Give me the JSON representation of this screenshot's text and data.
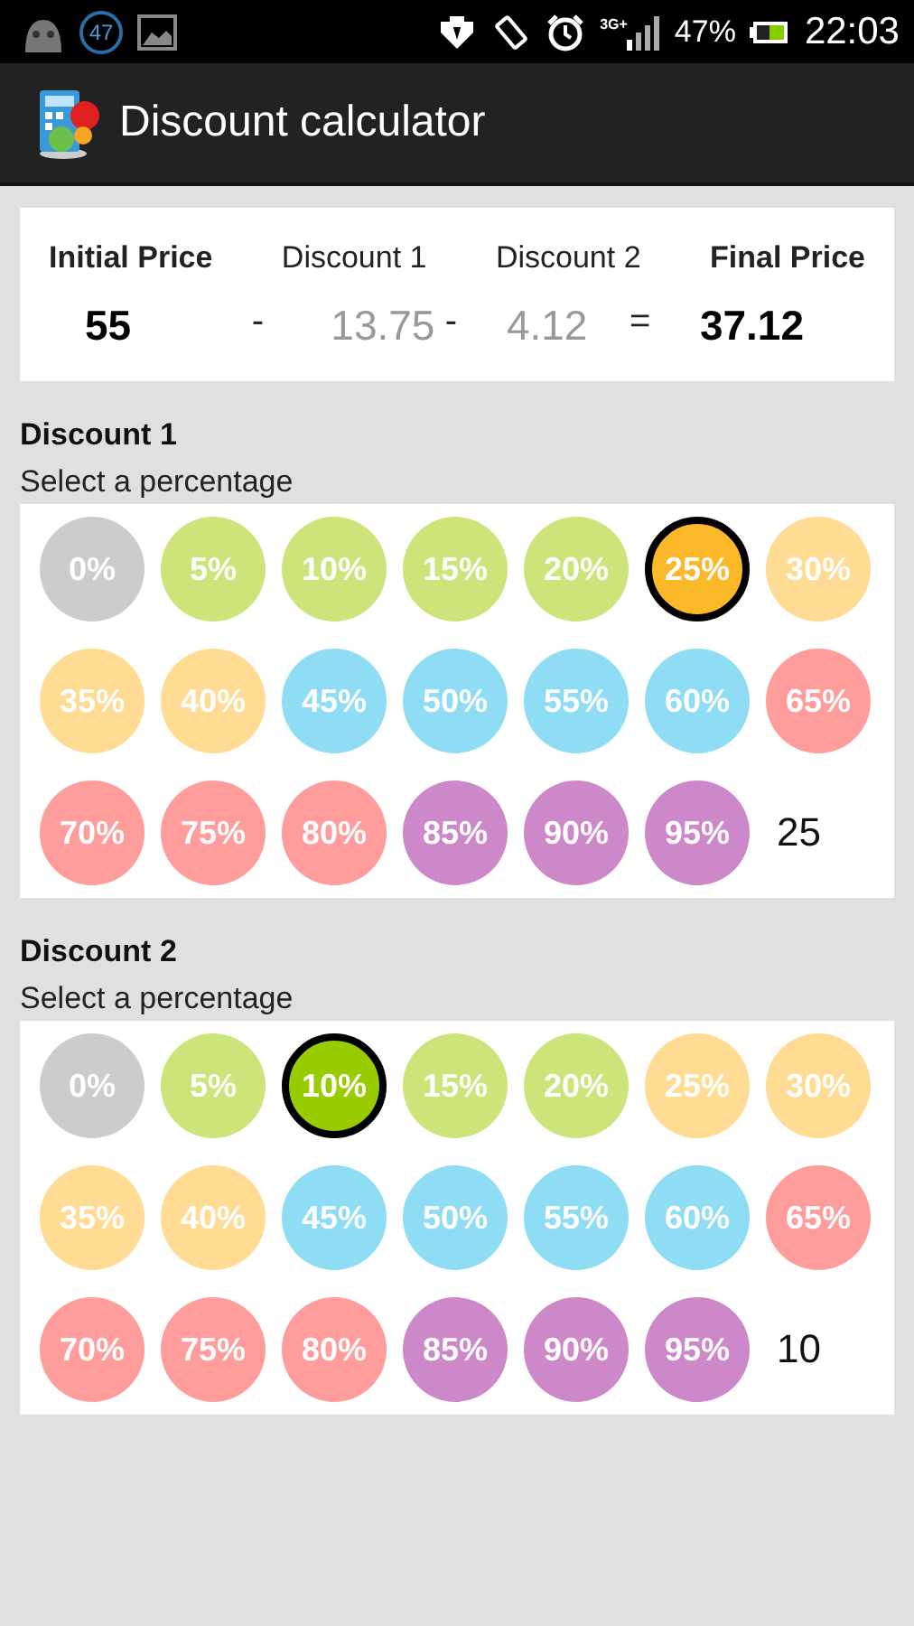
{
  "status_bar": {
    "notification_count": "47",
    "signal_label": "3G+",
    "battery": "47%",
    "time": "22:03"
  },
  "app_bar": {
    "title": "Discount calculator"
  },
  "summary": {
    "headers": [
      "Initial Price",
      "Discount 1",
      "Discount 2",
      "Final Price"
    ],
    "values": [
      {
        "kind": "main",
        "text": "55"
      },
      {
        "kind": "op",
        "text": "-"
      },
      {
        "kind": "muted",
        "text": "13.75"
      },
      {
        "kind": "op",
        "text": "-"
      },
      {
        "kind": "muted",
        "text": "4.12"
      },
      {
        "kind": "op",
        "text": "="
      },
      {
        "kind": "main",
        "text": "37.12"
      }
    ]
  },
  "sections": [
    {
      "title": "Discount 1",
      "hint": "Select a percentage",
      "value": "25",
      "options": [
        {
          "label": "0%",
          "color": "#cccccc",
          "selected": false
        },
        {
          "label": "5%",
          "color": "#cce47a",
          "selected": false
        },
        {
          "label": "10%",
          "color": "#cce47a",
          "selected": false
        },
        {
          "label": "15%",
          "color": "#cce47a",
          "selected": false
        },
        {
          "label": "20%",
          "color": "#cce47a",
          "selected": false
        },
        {
          "label": "25%",
          "color": "#fbb829",
          "selected": true
        },
        {
          "label": "30%",
          "color": "#ffdb94",
          "selected": false
        },
        {
          "label": "35%",
          "color": "#ffdb94",
          "selected": false
        },
        {
          "label": "40%",
          "color": "#ffdb94",
          "selected": false
        },
        {
          "label": "45%",
          "color": "#8fdcf5",
          "selected": false
        },
        {
          "label": "50%",
          "color": "#8fdcf5",
          "selected": false
        },
        {
          "label": "55%",
          "color": "#8fdcf5",
          "selected": false
        },
        {
          "label": "60%",
          "color": "#8fdcf5",
          "selected": false
        },
        {
          "label": "65%",
          "color": "#ff9c9c",
          "selected": false
        },
        {
          "label": "70%",
          "color": "#ff9c9c",
          "selected": false
        },
        {
          "label": "75%",
          "color": "#ff9c9c",
          "selected": false
        },
        {
          "label": "80%",
          "color": "#ff9c9c",
          "selected": false
        },
        {
          "label": "85%",
          "color": "#cc88c8",
          "selected": false
        },
        {
          "label": "90%",
          "color": "#cc88c8",
          "selected": false
        },
        {
          "label": "95%",
          "color": "#cc88c8",
          "selected": false
        }
      ]
    },
    {
      "title": "Discount 2",
      "hint": "Select a percentage",
      "value": "10",
      "options": [
        {
          "label": "0%",
          "color": "#cccccc",
          "selected": false
        },
        {
          "label": "5%",
          "color": "#cce47a",
          "selected": false
        },
        {
          "label": "10%",
          "color": "#99cc00",
          "selected": true
        },
        {
          "label": "15%",
          "color": "#cce47a",
          "selected": false
        },
        {
          "label": "20%",
          "color": "#cce47a",
          "selected": false
        },
        {
          "label": "25%",
          "color": "#ffdb94",
          "selected": false
        },
        {
          "label": "30%",
          "color": "#ffdb94",
          "selected": false
        },
        {
          "label": "35%",
          "color": "#ffdb94",
          "selected": false
        },
        {
          "label": "40%",
          "color": "#ffdb94",
          "selected": false
        },
        {
          "label": "45%",
          "color": "#8fdcf5",
          "selected": false
        },
        {
          "label": "50%",
          "color": "#8fdcf5",
          "selected": false
        },
        {
          "label": "55%",
          "color": "#8fdcf5",
          "selected": false
        },
        {
          "label": "60%",
          "color": "#8fdcf5",
          "selected": false
        },
        {
          "label": "65%",
          "color": "#ff9c9c",
          "selected": false
        },
        {
          "label": "70%",
          "color": "#ff9c9c",
          "selected": false
        },
        {
          "label": "75%",
          "color": "#ff9c9c",
          "selected": false
        },
        {
          "label": "80%",
          "color": "#ff9c9c",
          "selected": false
        },
        {
          "label": "85%",
          "color": "#cc88c8",
          "selected": false
        },
        {
          "label": "90%",
          "color": "#cc88c8",
          "selected": false
        },
        {
          "label": "95%",
          "color": "#cc88c8",
          "selected": false
        }
      ]
    }
  ]
}
